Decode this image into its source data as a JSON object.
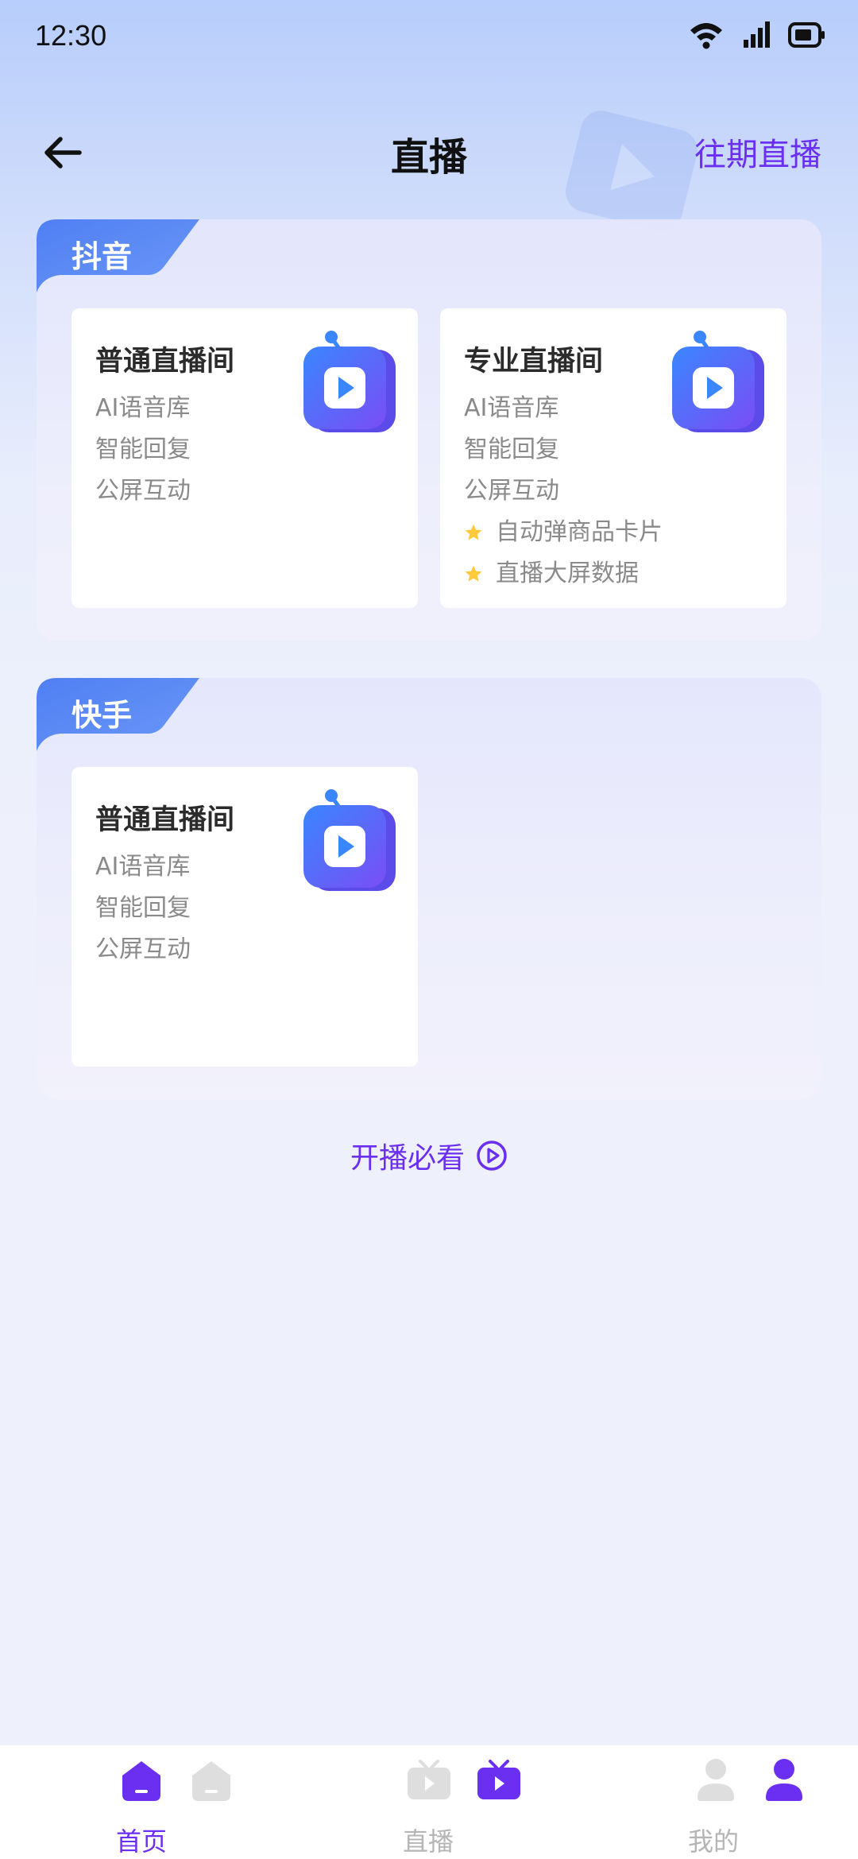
{
  "status_bar": {
    "time": "12:30"
  },
  "header": {
    "title": "直播",
    "history_link": "往期直播"
  },
  "sections": [
    {
      "platform": "抖音",
      "cards": [
        {
          "title": "普通直播间",
          "features": [
            "AI语音库",
            "智能回复",
            "公屏互动"
          ],
          "starred_features": []
        },
        {
          "title": "专业直播间",
          "features": [
            "AI语音库",
            "智能回复",
            "公屏互动"
          ],
          "starred_features": [
            "自动弹商品卡片",
            "直播大屏数据"
          ]
        }
      ]
    },
    {
      "platform": "快手",
      "cards": [
        {
          "title": "普通直播间",
          "features": [
            "AI语音库",
            "智能回复",
            "公屏互动"
          ],
          "starred_features": []
        }
      ]
    }
  ],
  "must_watch": {
    "label": "开播必看"
  },
  "bottom_nav": {
    "items": [
      {
        "label": "首页",
        "icon": "home-icon",
        "active": true
      },
      {
        "label": "直播",
        "icon": "tv-icon",
        "active": false
      },
      {
        "label": "我的",
        "icon": "user-icon",
        "active": false
      }
    ]
  },
  "colors": {
    "accent": "#6a2ff0",
    "tab_blue": "#5b8cf4",
    "star": "#ffc93a",
    "text_muted": "#8a8a8a"
  }
}
